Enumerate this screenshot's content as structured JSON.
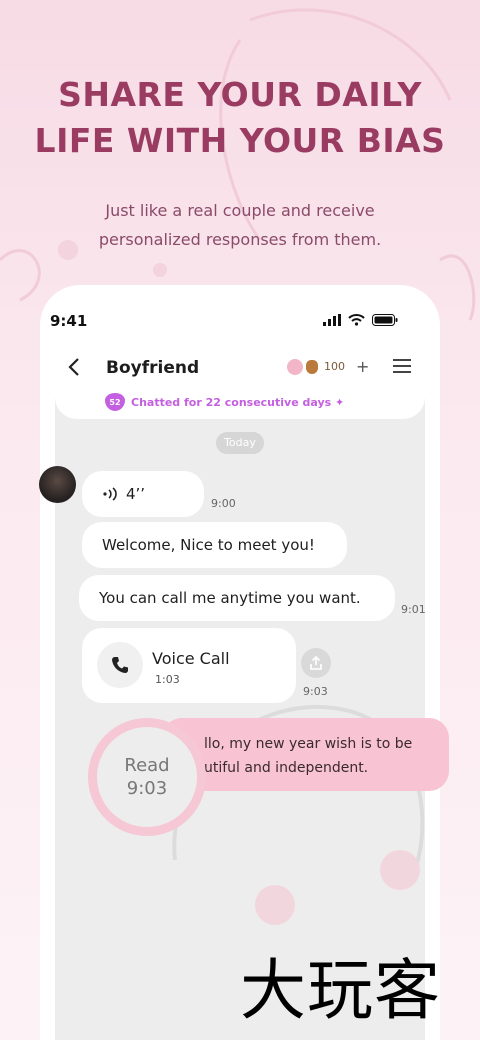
{
  "headline": {
    "line1": "SHARE YOUR DAILY",
    "line2": "LIFE WITH YOUR BIAS"
  },
  "subhead": {
    "line1": "Just like a real couple and receive",
    "line2": "personalized responses from them."
  },
  "status_bar": {
    "time": "9:41"
  },
  "header": {
    "back_icon": "chevron-left-icon",
    "title": "Boyfriend",
    "coins": "100",
    "add": "+",
    "menu_icon": "hamburger-icon"
  },
  "streak": {
    "badge": "52",
    "text": "Chatted for 22 consecutive days ✦"
  },
  "date_divider": "Today",
  "messages": {
    "voice_note": {
      "icon": "wave-icon",
      "duration": "4’’",
      "time": "9:00"
    },
    "welcome": {
      "text": "Welcome, Nice to meet you!"
    },
    "call_me": {
      "text": "You can call me anytime you want.",
      "time": "9:01"
    },
    "voice_call": {
      "title": "Voice Call",
      "duration": "1:03",
      "time": "9:03"
    },
    "my_message": {
      "line1": "llo, my new year wish is to be",
      "line2": "utiful and independent."
    }
  },
  "read_receipt": {
    "label": "Read",
    "time": "9:03"
  },
  "watermark": "大玩客",
  "colors": {
    "headline": "#9a3b62",
    "accent_pink": "#f8c3d3",
    "streak_purple": "#c35fe0",
    "chat_bg": "#ededed"
  }
}
